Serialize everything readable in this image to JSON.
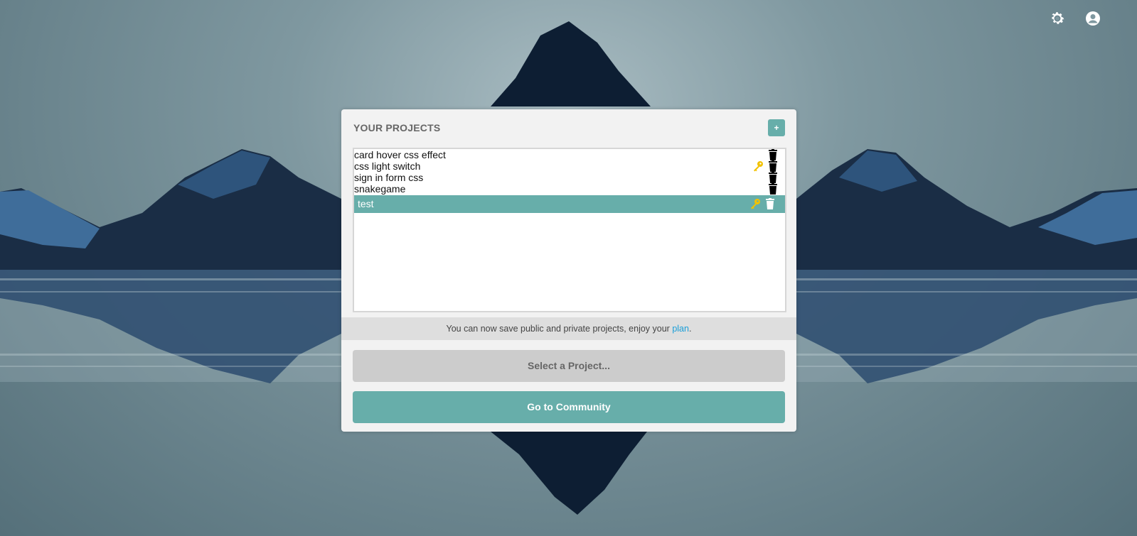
{
  "header": {
    "settings_icon": "gear-icon",
    "account_icon": "user-circle-icon"
  },
  "panel": {
    "title": "YOUR PROJECTS",
    "add_label": "+",
    "projects": [
      {
        "name": "card hover css effect",
        "private": false,
        "selected": false
      },
      {
        "name": "css light switch",
        "private": true,
        "selected": false
      },
      {
        "name": "sign in form css",
        "private": false,
        "selected": false
      },
      {
        "name": "snakegame",
        "private": false,
        "selected": false
      },
      {
        "name": "test",
        "private": true,
        "selected": true
      }
    ],
    "notice_text": "You can now save public and private projects, enjoy your ",
    "notice_link": "plan",
    "notice_end": ".",
    "select_button": "Select a Project...",
    "community_button": "Go to Community"
  },
  "colors": {
    "accent": "#67aeaa",
    "key": "#f2c200",
    "link": "#1a9ed8"
  }
}
